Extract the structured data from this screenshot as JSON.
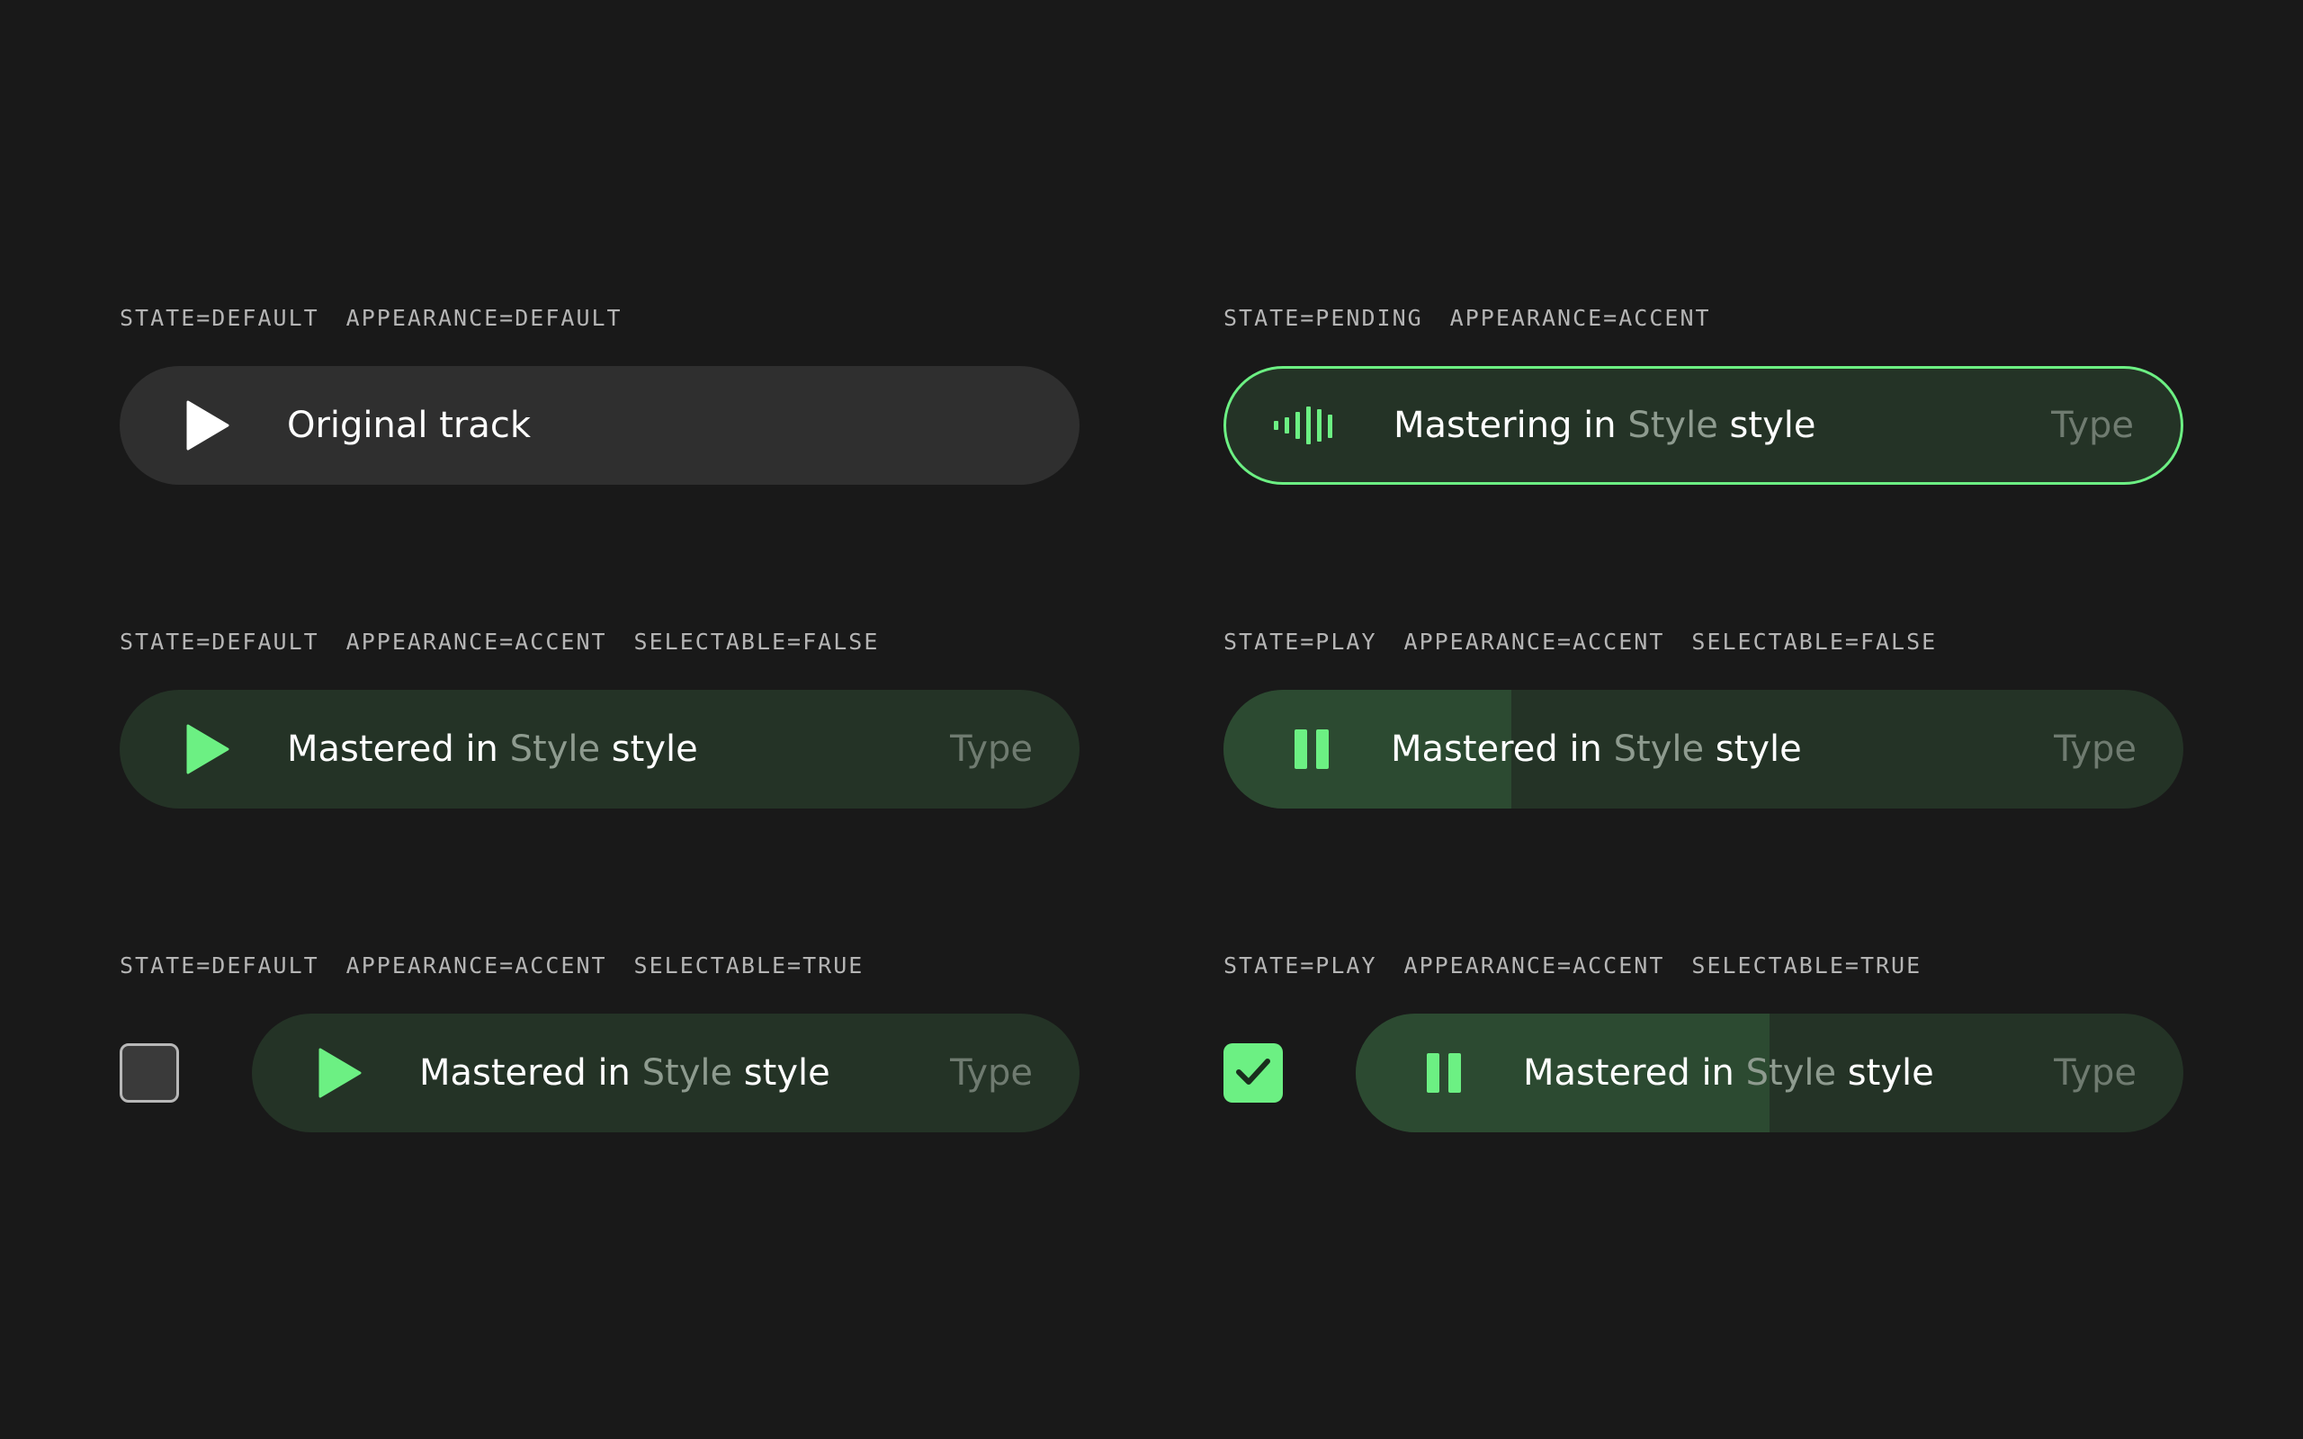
{
  "colors": {
    "background": "#191919",
    "accent": "#6cf083",
    "pill_default": "#2f2f2f",
    "pill_accent": "#243326",
    "progress_fill": "#2c4a31",
    "caption_text": "#b5b5b5",
    "muted_text": "#8e9b8f",
    "type_text": "#6f7b70"
  },
  "variants": [
    {
      "captions": [
        "STATE=DEFAULT",
        "APPEARANCE=DEFAULT"
      ],
      "icon": "play-icon",
      "title": "Original track"
    },
    {
      "captions": [
        "STATE=PENDING",
        "APPEARANCE=ACCENT"
      ],
      "icon": "waveform-icon",
      "title_prefix": "Mastering in ",
      "style_word": "Style",
      "title_suffix": " style",
      "type": "Type"
    },
    {
      "captions": [
        "STATE=DEFAULT",
        "APPEARANCE=ACCENT",
        "SELECTABLE=FALSE"
      ],
      "icon": "play-icon",
      "title_prefix": "Mastered in ",
      "style_word": "Style",
      "title_suffix": " style",
      "type": "Type"
    },
    {
      "captions": [
        "STATE=PLAY",
        "APPEARANCE=ACCENT",
        "SELECTABLE=FALSE"
      ],
      "icon": "pause-icon",
      "title_prefix": "Mastered in ",
      "style_word": "Style",
      "title_suffix": " style",
      "type": "Type",
      "progress": 0.3
    },
    {
      "captions": [
        "STATE=DEFAULT",
        "APPEARANCE=ACCENT",
        "SELECTABLE=TRUE"
      ],
      "icon": "play-icon",
      "checkbox_icon": "checkbox-unchecked-icon",
      "checked": false,
      "title_prefix": "Mastered in ",
      "style_word": "Style",
      "title_suffix": " style",
      "type": "Type"
    },
    {
      "captions": [
        "STATE=PLAY",
        "APPEARANCE=ACCENT",
        "SELECTABLE=TRUE"
      ],
      "icon": "pause-icon",
      "checkbox_icon": "checkmark-icon",
      "checked": true,
      "title_prefix": "Mastered in ",
      "style_word": "Style",
      "title_suffix": " style",
      "type": "Type",
      "progress": 0.5
    }
  ]
}
